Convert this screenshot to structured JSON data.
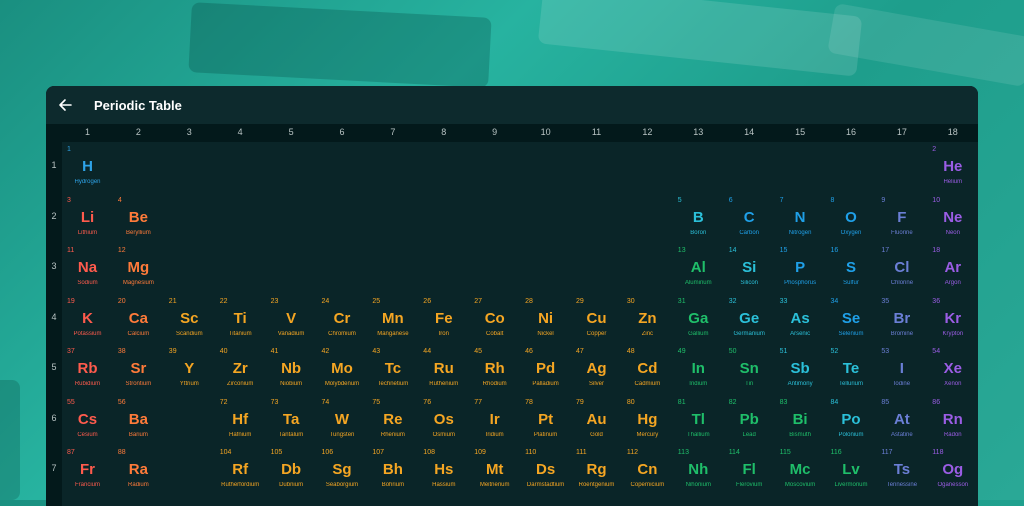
{
  "window": {
    "title": "Periodic Table"
  },
  "columns": [
    "1",
    "2",
    "3",
    "4",
    "5",
    "6",
    "7",
    "8",
    "9",
    "10",
    "11",
    "12",
    "13",
    "14",
    "15",
    "16",
    "17",
    "18"
  ],
  "rows": [
    "1",
    "2",
    "3",
    "4",
    "5",
    "6",
    "7"
  ],
  "colors": {
    "hydrogen": "#2ea3e8",
    "alkali": "#ff5b4d",
    "alkaline": "#ff7b3a",
    "transition": "#f5a623",
    "post_transition": "#1fbf6a",
    "metalloid": "#2bc0d9",
    "nonmetal": "#1fa0e8",
    "halogen": "#6b7fd6",
    "noble": "#9b5de5"
  },
  "elements": [
    {
      "n": "1",
      "s": "H",
      "name": "Hydrogen",
      "col": 1,
      "row": 1,
      "cat": "hydrogen"
    },
    {
      "n": "2",
      "s": "He",
      "name": "Helium",
      "col": 18,
      "row": 1,
      "cat": "noble"
    },
    {
      "n": "3",
      "s": "Li",
      "name": "Lithium",
      "col": 1,
      "row": 2,
      "cat": "alkali"
    },
    {
      "n": "4",
      "s": "Be",
      "name": "Beryllium",
      "col": 2,
      "row": 2,
      "cat": "alkaline"
    },
    {
      "n": "5",
      "s": "B",
      "name": "Boron",
      "col": 13,
      "row": 2,
      "cat": "metalloid"
    },
    {
      "n": "6",
      "s": "C",
      "name": "Carbon",
      "col": 14,
      "row": 2,
      "cat": "nonmetal"
    },
    {
      "n": "7",
      "s": "N",
      "name": "Nitrogen",
      "col": 15,
      "row": 2,
      "cat": "nonmetal"
    },
    {
      "n": "8",
      "s": "O",
      "name": "Oxygen",
      "col": 16,
      "row": 2,
      "cat": "nonmetal"
    },
    {
      "n": "9",
      "s": "F",
      "name": "Fluorine",
      "col": 17,
      "row": 2,
      "cat": "halogen"
    },
    {
      "n": "10",
      "s": "Ne",
      "name": "Neon",
      "col": 18,
      "row": 2,
      "cat": "noble"
    },
    {
      "n": "11",
      "s": "Na",
      "name": "Sodium",
      "col": 1,
      "row": 3,
      "cat": "alkali"
    },
    {
      "n": "12",
      "s": "Mg",
      "name": "Magnesium",
      "col": 2,
      "row": 3,
      "cat": "alkaline"
    },
    {
      "n": "13",
      "s": "Al",
      "name": "Aluminum",
      "col": 13,
      "row": 3,
      "cat": "post_transition"
    },
    {
      "n": "14",
      "s": "Si",
      "name": "Silicon",
      "col": 14,
      "row": 3,
      "cat": "metalloid"
    },
    {
      "n": "15",
      "s": "P",
      "name": "Phosphorus",
      "col": 15,
      "row": 3,
      "cat": "nonmetal"
    },
    {
      "n": "16",
      "s": "S",
      "name": "Sulfur",
      "col": 16,
      "row": 3,
      "cat": "nonmetal"
    },
    {
      "n": "17",
      "s": "Cl",
      "name": "Chlorine",
      "col": 17,
      "row": 3,
      "cat": "halogen"
    },
    {
      "n": "18",
      "s": "Ar",
      "name": "Argon",
      "col": 18,
      "row": 3,
      "cat": "noble"
    },
    {
      "n": "19",
      "s": "K",
      "name": "Potassium",
      "col": 1,
      "row": 4,
      "cat": "alkali"
    },
    {
      "n": "20",
      "s": "Ca",
      "name": "Calcium",
      "col": 2,
      "row": 4,
      "cat": "alkaline"
    },
    {
      "n": "21",
      "s": "Sc",
      "name": "Scandium",
      "col": 3,
      "row": 4,
      "cat": "transition"
    },
    {
      "n": "22",
      "s": "Ti",
      "name": "Titanium",
      "col": 4,
      "row": 4,
      "cat": "transition"
    },
    {
      "n": "23",
      "s": "V",
      "name": "Vanadium",
      "col": 5,
      "row": 4,
      "cat": "transition"
    },
    {
      "n": "24",
      "s": "Cr",
      "name": "Chromium",
      "col": 6,
      "row": 4,
      "cat": "transition"
    },
    {
      "n": "25",
      "s": "Mn",
      "name": "Manganese",
      "col": 7,
      "row": 4,
      "cat": "transition"
    },
    {
      "n": "26",
      "s": "Fe",
      "name": "Iron",
      "col": 8,
      "row": 4,
      "cat": "transition"
    },
    {
      "n": "27",
      "s": "Co",
      "name": "Cobalt",
      "col": 9,
      "row": 4,
      "cat": "transition"
    },
    {
      "n": "28",
      "s": "Ni",
      "name": "Nickel",
      "col": 10,
      "row": 4,
      "cat": "transition"
    },
    {
      "n": "29",
      "s": "Cu",
      "name": "Copper",
      "col": 11,
      "row": 4,
      "cat": "transition"
    },
    {
      "n": "30",
      "s": "Zn",
      "name": "Zinc",
      "col": 12,
      "row": 4,
      "cat": "transition"
    },
    {
      "n": "31",
      "s": "Ga",
      "name": "Gallium",
      "col": 13,
      "row": 4,
      "cat": "post_transition"
    },
    {
      "n": "32",
      "s": "Ge",
      "name": "Germanium",
      "col": 14,
      "row": 4,
      "cat": "metalloid"
    },
    {
      "n": "33",
      "s": "As",
      "name": "Arsenic",
      "col": 15,
      "row": 4,
      "cat": "metalloid"
    },
    {
      "n": "34",
      "s": "Se",
      "name": "Selenium",
      "col": 16,
      "row": 4,
      "cat": "nonmetal"
    },
    {
      "n": "35",
      "s": "Br",
      "name": "Bromine",
      "col": 17,
      "row": 4,
      "cat": "halogen"
    },
    {
      "n": "36",
      "s": "Kr",
      "name": "Krypton",
      "col": 18,
      "row": 4,
      "cat": "noble"
    },
    {
      "n": "37",
      "s": "Rb",
      "name": "Rubidium",
      "col": 1,
      "row": 5,
      "cat": "alkali"
    },
    {
      "n": "38",
      "s": "Sr",
      "name": "Strontium",
      "col": 2,
      "row": 5,
      "cat": "alkaline"
    },
    {
      "n": "39",
      "s": "Y",
      "name": "Yttrium",
      "col": 3,
      "row": 5,
      "cat": "transition"
    },
    {
      "n": "40",
      "s": "Zr",
      "name": "Zirconium",
      "col": 4,
      "row": 5,
      "cat": "transition"
    },
    {
      "n": "41",
      "s": "Nb",
      "name": "Niobium",
      "col": 5,
      "row": 5,
      "cat": "transition"
    },
    {
      "n": "42",
      "s": "Mo",
      "name": "Molybdenum",
      "col": 6,
      "row": 5,
      "cat": "transition"
    },
    {
      "n": "43",
      "s": "Tc",
      "name": "Technetium",
      "col": 7,
      "row": 5,
      "cat": "transition"
    },
    {
      "n": "44",
      "s": "Ru",
      "name": "Ruthenium",
      "col": 8,
      "row": 5,
      "cat": "transition"
    },
    {
      "n": "45",
      "s": "Rh",
      "name": "Rhodium",
      "col": 9,
      "row": 5,
      "cat": "transition"
    },
    {
      "n": "46",
      "s": "Pd",
      "name": "Palladium",
      "col": 10,
      "row": 5,
      "cat": "transition"
    },
    {
      "n": "47",
      "s": "Ag",
      "name": "Silver",
      "col": 11,
      "row": 5,
      "cat": "transition"
    },
    {
      "n": "48",
      "s": "Cd",
      "name": "Cadmium",
      "col": 12,
      "row": 5,
      "cat": "transition"
    },
    {
      "n": "49",
      "s": "In",
      "name": "Indium",
      "col": 13,
      "row": 5,
      "cat": "post_transition"
    },
    {
      "n": "50",
      "s": "Sn",
      "name": "Tin",
      "col": 14,
      "row": 5,
      "cat": "post_transition"
    },
    {
      "n": "51",
      "s": "Sb",
      "name": "Antimony",
      "col": 15,
      "row": 5,
      "cat": "metalloid"
    },
    {
      "n": "52",
      "s": "Te",
      "name": "Tellurium",
      "col": 16,
      "row": 5,
      "cat": "metalloid"
    },
    {
      "n": "53",
      "s": "I",
      "name": "Iodine",
      "col": 17,
      "row": 5,
      "cat": "halogen"
    },
    {
      "n": "54",
      "s": "Xe",
      "name": "Xenon",
      "col": 18,
      "row": 5,
      "cat": "noble"
    },
    {
      "n": "55",
      "s": "Cs",
      "name": "Cesium",
      "col": 1,
      "row": 6,
      "cat": "alkali"
    },
    {
      "n": "56",
      "s": "Ba",
      "name": "Barium",
      "col": 2,
      "row": 6,
      "cat": "alkaline"
    },
    {
      "n": "72",
      "s": "Hf",
      "name": "Hafnium",
      "col": 4,
      "row": 6,
      "cat": "transition"
    },
    {
      "n": "73",
      "s": "Ta",
      "name": "Tantalum",
      "col": 5,
      "row": 6,
      "cat": "transition"
    },
    {
      "n": "74",
      "s": "W",
      "name": "Tungsten",
      "col": 6,
      "row": 6,
      "cat": "transition"
    },
    {
      "n": "75",
      "s": "Re",
      "name": "Rhenium",
      "col": 7,
      "row": 6,
      "cat": "transition"
    },
    {
      "n": "76",
      "s": "Os",
      "name": "Osmium",
      "col": 8,
      "row": 6,
      "cat": "transition"
    },
    {
      "n": "77",
      "s": "Ir",
      "name": "Iridium",
      "col": 9,
      "row": 6,
      "cat": "transition"
    },
    {
      "n": "78",
      "s": "Pt",
      "name": "Platinum",
      "col": 10,
      "row": 6,
      "cat": "transition"
    },
    {
      "n": "79",
      "s": "Au",
      "name": "Gold",
      "col": 11,
      "row": 6,
      "cat": "transition"
    },
    {
      "n": "80",
      "s": "Hg",
      "name": "Mercury",
      "col": 12,
      "row": 6,
      "cat": "transition"
    },
    {
      "n": "81",
      "s": "Tl",
      "name": "Thallium",
      "col": 13,
      "row": 6,
      "cat": "post_transition"
    },
    {
      "n": "82",
      "s": "Pb",
      "name": "Lead",
      "col": 14,
      "row": 6,
      "cat": "post_transition"
    },
    {
      "n": "83",
      "s": "Bi",
      "name": "Bismuth",
      "col": 15,
      "row": 6,
      "cat": "post_transition"
    },
    {
      "n": "84",
      "s": "Po",
      "name": "Polonium",
      "col": 16,
      "row": 6,
      "cat": "metalloid"
    },
    {
      "n": "85",
      "s": "At",
      "name": "Astatine",
      "col": 17,
      "row": 6,
      "cat": "halogen"
    },
    {
      "n": "86",
      "s": "Rn",
      "name": "Radon",
      "col": 18,
      "row": 6,
      "cat": "noble"
    },
    {
      "n": "87",
      "s": "Fr",
      "name": "Francium",
      "col": 1,
      "row": 7,
      "cat": "alkali"
    },
    {
      "n": "88",
      "s": "Ra",
      "name": "Radium",
      "col": 2,
      "row": 7,
      "cat": "alkaline"
    },
    {
      "n": "104",
      "s": "Rf",
      "name": "Rutherfordium",
      "col": 4,
      "row": 7,
      "cat": "transition"
    },
    {
      "n": "105",
      "s": "Db",
      "name": "Dubnium",
      "col": 5,
      "row": 7,
      "cat": "transition"
    },
    {
      "n": "106",
      "s": "Sg",
      "name": "Seaborgium",
      "col": 6,
      "row": 7,
      "cat": "transition"
    },
    {
      "n": "107",
      "s": "Bh",
      "name": "Bohrium",
      "col": 7,
      "row": 7,
      "cat": "transition"
    },
    {
      "n": "108",
      "s": "Hs",
      "name": "Hassium",
      "col": 8,
      "row": 7,
      "cat": "transition"
    },
    {
      "n": "109",
      "s": "Mt",
      "name": "Meitnerium",
      "col": 9,
      "row": 7,
      "cat": "transition"
    },
    {
      "n": "110",
      "s": "Ds",
      "name": "Darmstadtium",
      "col": 10,
      "row": 7,
      "cat": "transition"
    },
    {
      "n": "111",
      "s": "Rg",
      "name": "Roentgenium",
      "col": 11,
      "row": 7,
      "cat": "transition"
    },
    {
      "n": "112",
      "s": "Cn",
      "name": "Copernicium",
      "col": 12,
      "row": 7,
      "cat": "transition"
    },
    {
      "n": "113",
      "s": "Nh",
      "name": "Nihonium",
      "col": 13,
      "row": 7,
      "cat": "post_transition"
    },
    {
      "n": "114",
      "s": "Fl",
      "name": "Flerovium",
      "col": 14,
      "row": 7,
      "cat": "post_transition"
    },
    {
      "n": "115",
      "s": "Mc",
      "name": "Moscovium",
      "col": 15,
      "row": 7,
      "cat": "post_transition"
    },
    {
      "n": "116",
      "s": "Lv",
      "name": "Livermorium",
      "col": 16,
      "row": 7,
      "cat": "post_transition"
    },
    {
      "n": "117",
      "s": "Ts",
      "name": "Tennessine",
      "col": 17,
      "row": 7,
      "cat": "halogen"
    },
    {
      "n": "118",
      "s": "Og",
      "name": "Oganesson",
      "col": 18,
      "row": 7,
      "cat": "noble"
    }
  ]
}
